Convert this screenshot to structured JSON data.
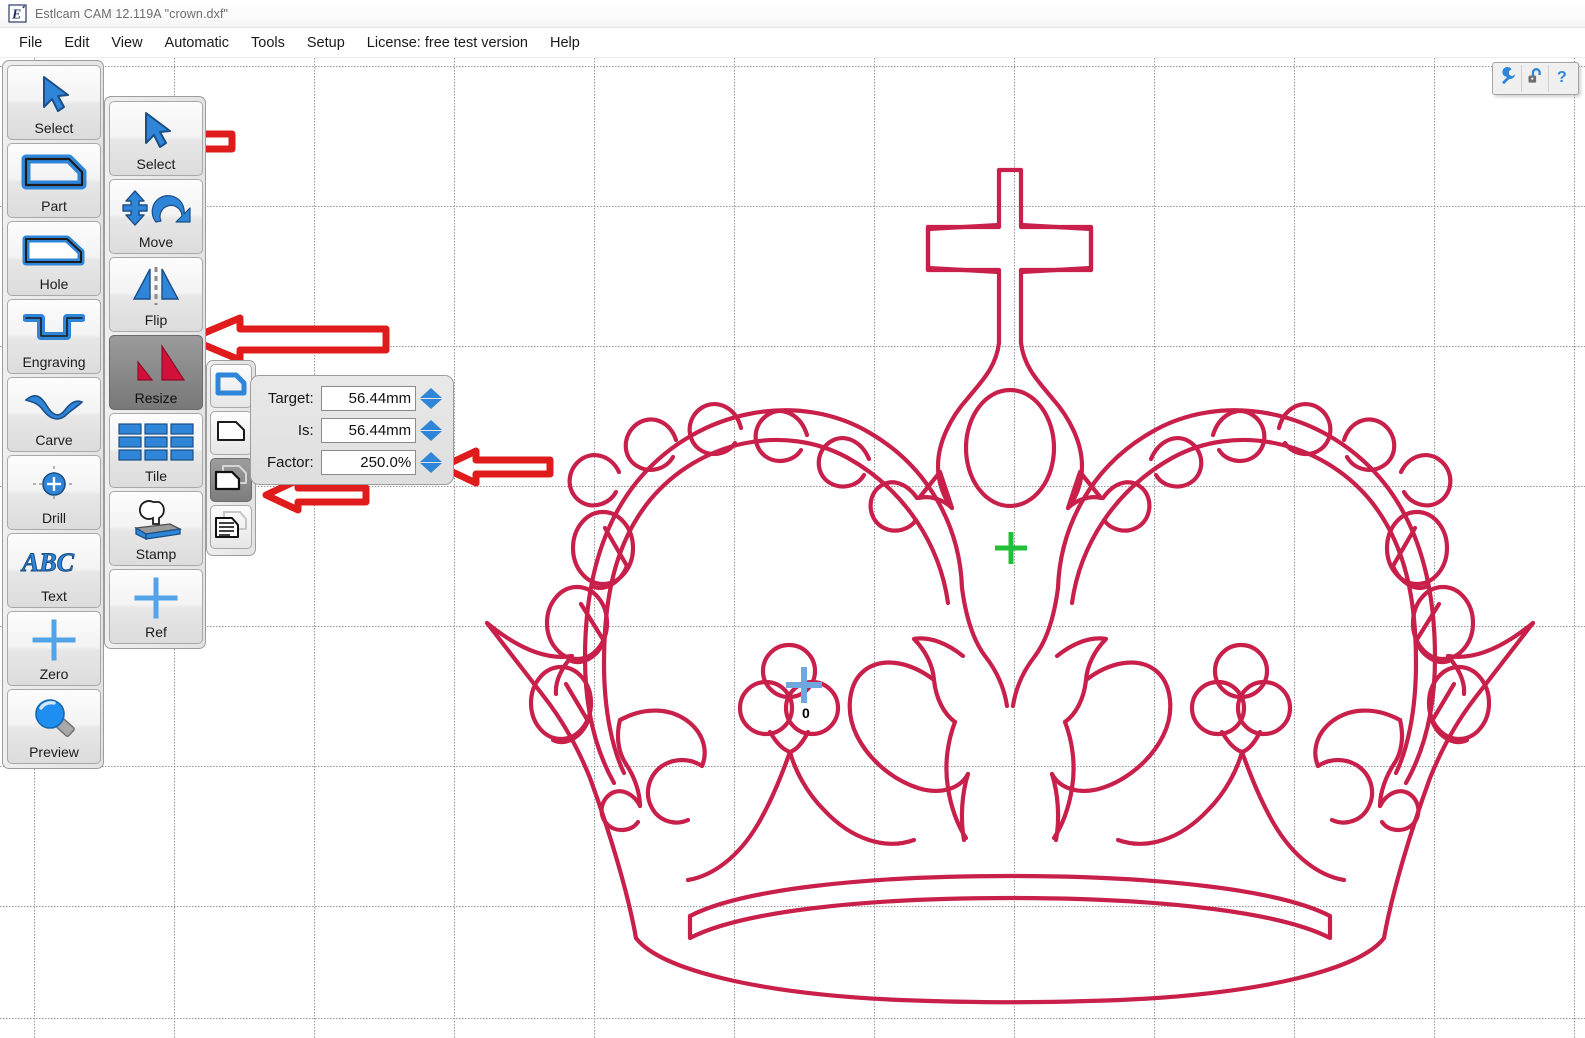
{
  "window": {
    "title": "Estlcam CAM 12.119A \"crown.dxf\"",
    "app_icon": "estlcam-e-icon"
  },
  "menubar": {
    "items": [
      {
        "label": "File"
      },
      {
        "label": "Edit"
      },
      {
        "label": "View"
      },
      {
        "label": "Automatic"
      },
      {
        "label": "Tools"
      },
      {
        "label": "Setup"
      },
      {
        "label": "License: free test version"
      },
      {
        "label": "Help"
      }
    ]
  },
  "primary_toolbar": {
    "buttons": [
      {
        "label": "Select",
        "icon": "cursor-arrow-icon",
        "active": false
      },
      {
        "label": "Part",
        "icon": "part-outline-icon",
        "active": false
      },
      {
        "label": "Hole",
        "icon": "hole-outline-icon",
        "active": false
      },
      {
        "label": "Engraving",
        "icon": "engraving-icon",
        "active": false
      },
      {
        "label": "Carve",
        "icon": "carve-wave-icon",
        "active": false
      },
      {
        "label": "Drill",
        "icon": "drill-target-icon",
        "active": false
      },
      {
        "label": "Text",
        "icon": "abc-text-icon",
        "active": false
      },
      {
        "label": "Zero",
        "icon": "zero-cross-icon",
        "active": false
      },
      {
        "label": "Preview",
        "icon": "magnifier-icon",
        "active": false
      }
    ]
  },
  "secondary_toolbar": {
    "buttons": [
      {
        "label": "Select",
        "icon": "cursor-arrow-icon",
        "active": false
      },
      {
        "label": "Move",
        "icon": "move-rotate-icon",
        "active": false
      },
      {
        "label": "Flip",
        "icon": "flip-mirror-icon",
        "active": false
      },
      {
        "label": "Resize",
        "icon": "resize-triangle-icon",
        "active": true
      },
      {
        "label": "Tile",
        "icon": "tile-grid-icon",
        "active": false
      },
      {
        "label": "Stamp",
        "icon": "stamp-icon",
        "active": false
      },
      {
        "label": "Ref",
        "icon": "ref-cross-icon",
        "active": false
      }
    ]
  },
  "mode_toolbar": {
    "buttons": [
      {
        "name": "scale-selected-shape",
        "icon": "blue-shape-icon",
        "active": false
      },
      {
        "name": "scale-single-shape",
        "icon": "outline-shape-icon",
        "active": false
      },
      {
        "name": "scale-all-shapes",
        "icon": "two-shapes-icon",
        "active": true
      },
      {
        "name": "scale-with-text",
        "icon": "shape-with-lines-icon",
        "active": false
      }
    ]
  },
  "resize_dialog": {
    "rows": [
      {
        "label": "Target:",
        "value": "56.44mm",
        "spinner": "up-down-spinner"
      },
      {
        "label": "Is:",
        "value": "56.44mm",
        "spinner": "up-down-spinner"
      },
      {
        "label": "Factor:",
        "value": "250.0%",
        "spinner": "up-down-spinner"
      }
    ]
  },
  "corner_toolbar": {
    "items": [
      {
        "name": "setup-wrench",
        "icon": "wrench-icon"
      },
      {
        "name": "unlock",
        "icon": "padlock-open-icon"
      },
      {
        "name": "help",
        "icon": "question-mark-icon"
      }
    ]
  },
  "canvas": {
    "origin_label": "0",
    "origin_marker_color": "#6fa8dc",
    "reference_marker_color": "#22c03a",
    "drawing_color": "#c8204a",
    "grid_color": "#9a9a9a",
    "background": "#ffffff",
    "drawing_name": "crown.dxf"
  },
  "annotations": {
    "arrow_color": "#e01b1b",
    "arrows": [
      {
        "name": "arrow-to-select-button",
        "points_to": "Select"
      },
      {
        "name": "arrow-to-resize-button",
        "points_to": "Resize"
      },
      {
        "name": "arrow-to-factor-field",
        "points_to": "Factor:"
      },
      {
        "name": "arrow-to-scale-all-mode",
        "points_to": "scale-all-shapes"
      }
    ]
  }
}
